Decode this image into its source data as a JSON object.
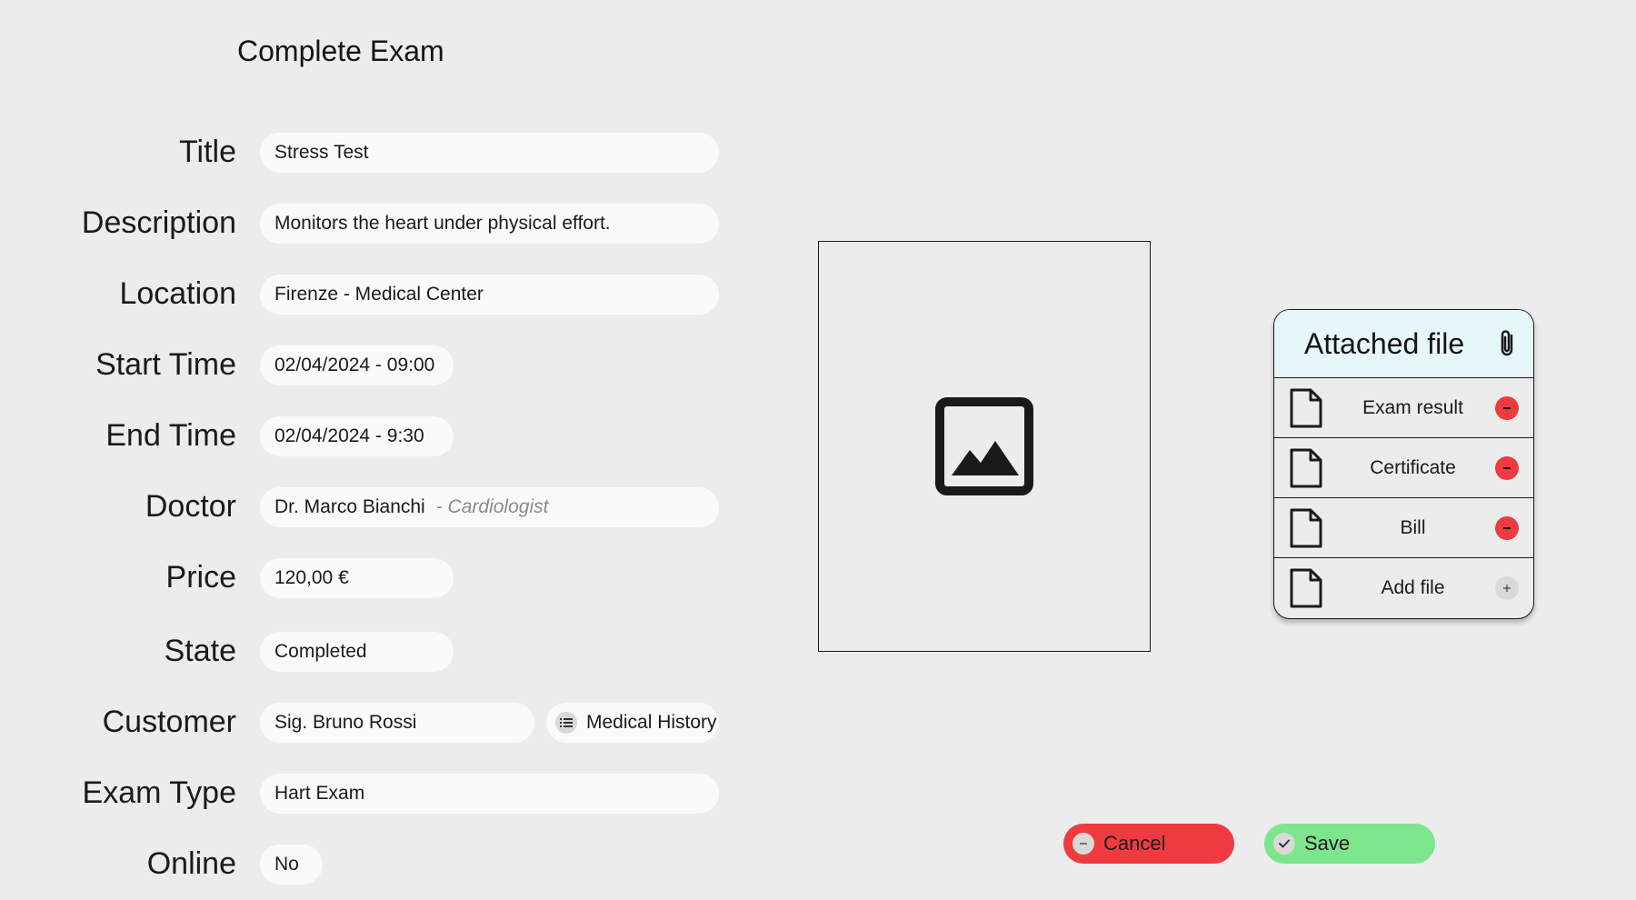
{
  "page": {
    "title": "Complete Exam"
  },
  "form": {
    "title": {
      "label": "Title",
      "value": "Stress Test"
    },
    "description": {
      "label": "Description",
      "value": "Monitors the heart under physical effort."
    },
    "location": {
      "label": "Location",
      "value": "Firenze - Medical Center"
    },
    "start_time": {
      "label": "Start Time",
      "value": "02/04/2024 - 09:00"
    },
    "end_time": {
      "label": "End Time",
      "value": "02/04/2024 - 9:30"
    },
    "doctor": {
      "label": "Doctor",
      "value": "Dr. Marco Bianchi",
      "specialty": "- Cardiologist"
    },
    "price": {
      "label": "Price",
      "value": "120,00 €"
    },
    "state": {
      "label": "State",
      "value": "Completed"
    },
    "customer": {
      "label": "Customer",
      "value": "Sig. Bruno Rossi",
      "history_button": "Medical History"
    },
    "exam_type": {
      "label": "Exam Type",
      "value": "Hart Exam"
    },
    "online": {
      "label": "Online",
      "value": "No"
    }
  },
  "preview": {
    "icon": "image-placeholder-icon"
  },
  "attachments": {
    "header": "Attached file",
    "header_icon": "paperclip-icon",
    "files": [
      {
        "label": "Exam result",
        "icon": "file-icon",
        "action": "remove"
      },
      {
        "label": "Certificate",
        "icon": "file-icon",
        "action": "remove"
      },
      {
        "label": "Bill",
        "icon": "file-icon",
        "action": "remove"
      }
    ],
    "add_label": "Add file"
  },
  "footer": {
    "cancel_label": "Cancel",
    "save_label": "Save"
  },
  "colors": {
    "background": "#ececec",
    "field_bg": "#fafafa",
    "cancel": "#ef3b3f",
    "save": "#7de58c",
    "attach_header": "#e6f7f9"
  }
}
